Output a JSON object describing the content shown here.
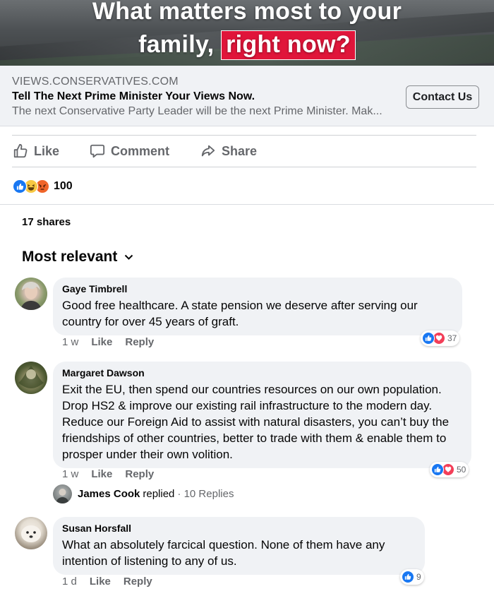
{
  "ad": {
    "headline_line1": "What matters most to your",
    "headline_line2_plain": "family, ",
    "headline_line2_highlight": "right now?",
    "link_domain": "VIEWS.CONSERVATIVES.COM",
    "link_title": "Tell The Next Prime Minister Your Views Now.",
    "link_description": "The next Conservative Party Leader will be the next Prime Minister. Mak...",
    "cta_label": "Contact Us"
  },
  "actions": {
    "like": "Like",
    "comment": "Comment",
    "share": "Share"
  },
  "reactions": {
    "icons": [
      "like-icon",
      "haha-icon",
      "angry-icon"
    ],
    "count": "100"
  },
  "shares_text": "17 shares",
  "sort_label": "Most relevant",
  "comments": [
    {
      "name": "Gaye Timbrell",
      "text": "Good free healthcare. A state pension we deserve after serving our country for over 45 years of graft.",
      "time": "1 w",
      "like": "Like",
      "reply": "Reply",
      "reaction_icons": [
        "like-icon",
        "love-icon"
      ],
      "reaction_count": "37"
    },
    {
      "name": "Margaret Dawson",
      "text": "Exit the EU, then spend our countries resources on our own population. Drop HS2 & improve our existing rail infrastructure to the modern day. Reduce our Foreign Aid to assist with natural disasters, you can’t buy the friendships of other countries, better to trade with them & enable them to prosper under their own volition.",
      "time": "1 w",
      "like": "Like",
      "reply": "Reply",
      "reaction_icons": [
        "like-icon",
        "love-icon"
      ],
      "reaction_count": "50"
    },
    {
      "name": "Susan Horsfall",
      "text": "What an absolutely farcical question. None of them have any intention of listening to any of us.",
      "time": "1 d",
      "like": "Like",
      "reply": "Reply",
      "reaction_icons": [
        "like-icon"
      ],
      "reaction_count": "9"
    }
  ],
  "reply_summary": {
    "name": "James Cook",
    "verb": "replied",
    "count": "· 10 Replies"
  },
  "colors": {
    "fb_blue": "#1877f2",
    "love_red": "#f33e58",
    "highlight_red": "#e0153a",
    "secondary_text": "#65676b",
    "bubble_bg": "#f0f2f5"
  }
}
